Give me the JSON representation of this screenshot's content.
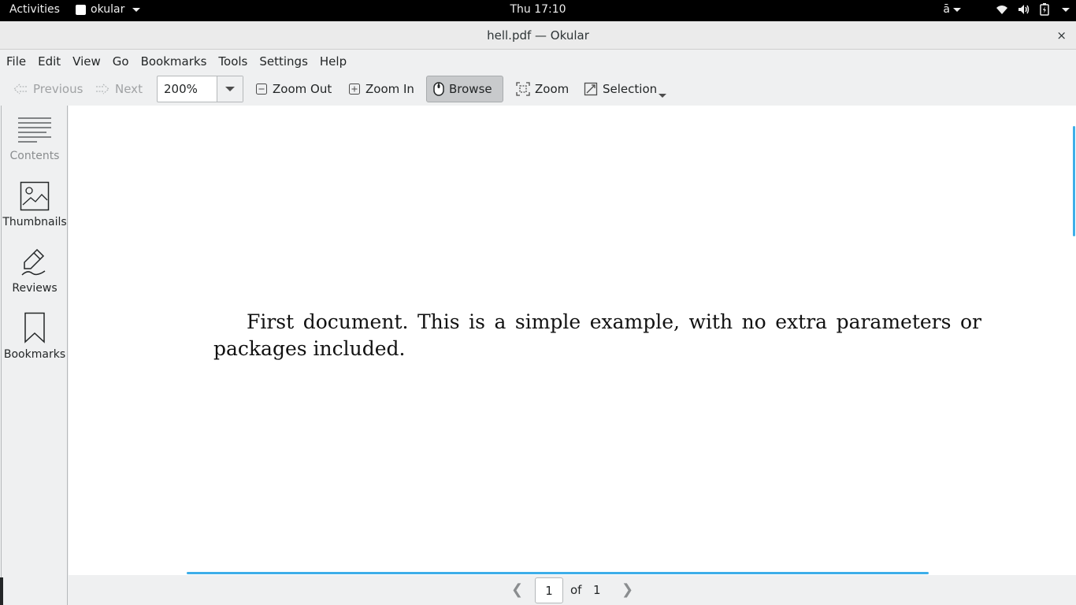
{
  "topbar": {
    "activities": "Activities",
    "app_name": "okular",
    "clock": "Thu 17:10",
    "input_method": "ā"
  },
  "window": {
    "title": "hell.pdf — Okular",
    "close": "×"
  },
  "menubar": {
    "items": [
      "File",
      "Edit",
      "View",
      "Go",
      "Bookmarks",
      "Tools",
      "Settings",
      "Help"
    ]
  },
  "toolbar": {
    "previous": "Previous",
    "next": "Next",
    "zoom_value": "200%",
    "zoom_out": "Zoom Out",
    "zoom_in": "Zoom In",
    "browse": "Browse",
    "zoom": "Zoom",
    "selection": "Selection"
  },
  "sidebar": {
    "items": [
      {
        "label": "Contents",
        "icon": "contents-icon"
      },
      {
        "label": "Thumbnails",
        "icon": "thumbnails-icon"
      },
      {
        "label": "Reviews",
        "icon": "reviews-icon"
      },
      {
        "label": "Bookmarks",
        "icon": "bookmarks-icon"
      }
    ]
  },
  "document": {
    "text": "First document. This is a simple example, with no extra parameters or packages included."
  },
  "pagebar": {
    "current_page": "1",
    "of_label": "of",
    "total_pages": "1"
  },
  "colors": {
    "accent": "#3daee9",
    "topbar_bg": "#000000",
    "window_bg": "#eff0f1"
  }
}
